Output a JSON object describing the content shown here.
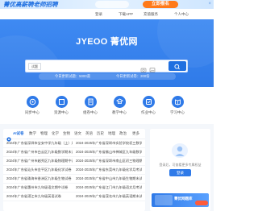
{
  "banner": {
    "text": "菁优高薪聘老师招聘",
    "button_label": "立即报名",
    "close": "×"
  },
  "nav": {
    "items": [
      "登录",
      "下载APP",
      "充值服务",
      "个人中心"
    ]
  },
  "hero": {
    "logo": "JYEOO 菁优网",
    "search": {
      "select_value": "试题",
      "placeholder": "",
      "value": ""
    },
    "subbar": {
      "left": "今日更新试题：5000道",
      "right": "今日更新试卷：200份"
    }
  },
  "features": [
    {
      "label": "同步中心",
      "icon": "sync-icon"
    },
    {
      "label": "资源中心",
      "icon": "resource-icon"
    },
    {
      "label": "组卷中心",
      "icon": "paper-icon"
    },
    {
      "label": "教学中心",
      "icon": "teaching-icon"
    },
    {
      "label": "作业中心",
      "icon": "homework-icon"
    },
    {
      "label": "学习中心",
      "icon": "study-icon"
    }
  ],
  "tabs": {
    "items": [
      "AI试卷",
      "数学",
      "物理",
      "化学",
      "生物",
      "语文",
      "英语",
      "历史",
      "地理",
      "政治",
      "更多"
    ]
  },
  "rows": [
    [
      "2024年广东省深圳市宝安中学九年级（上）月考数学试卷",
      "2024-2025年广东省深圳市实验学校初三数学月考试卷"
    ],
    [
      "2024年广东省广州市白云区九年级数学期末试卷",
      "2024-2025年广东省佛山市禅城区九年级数学期末卷"
    ],
    [
      "2024年广东省广州市越秀区九年级物理期中试卷",
      "2024-2025年广东省深圳市南山区初三物理期中试卷"
    ],
    [
      "2024年广东省汕头市金平区九年级化学试卷",
      "2024-2025年广东省东莞市九年级化学月考试卷"
    ],
    [
      "2024年广东省珠海市香洲区九年级生物试卷",
      "2024-2025年广东省中山市九年级生物期末试卷"
    ],
    [
      "2024年广东省惠州市九年级语文期中试卷",
      "2024-2025年广东省江门市九年级语文月考试卷"
    ],
    [
      "2024年广东省湛江市九年级英语试卷",
      "2024-2025年广东省茂名市九年级英语期末试卷"
    ]
  ],
  "right_panel": {
    "hint": "登录后，可查看更多专属权益",
    "login_button": "登录",
    "mini_banner_text": "菁优网题库"
  }
}
